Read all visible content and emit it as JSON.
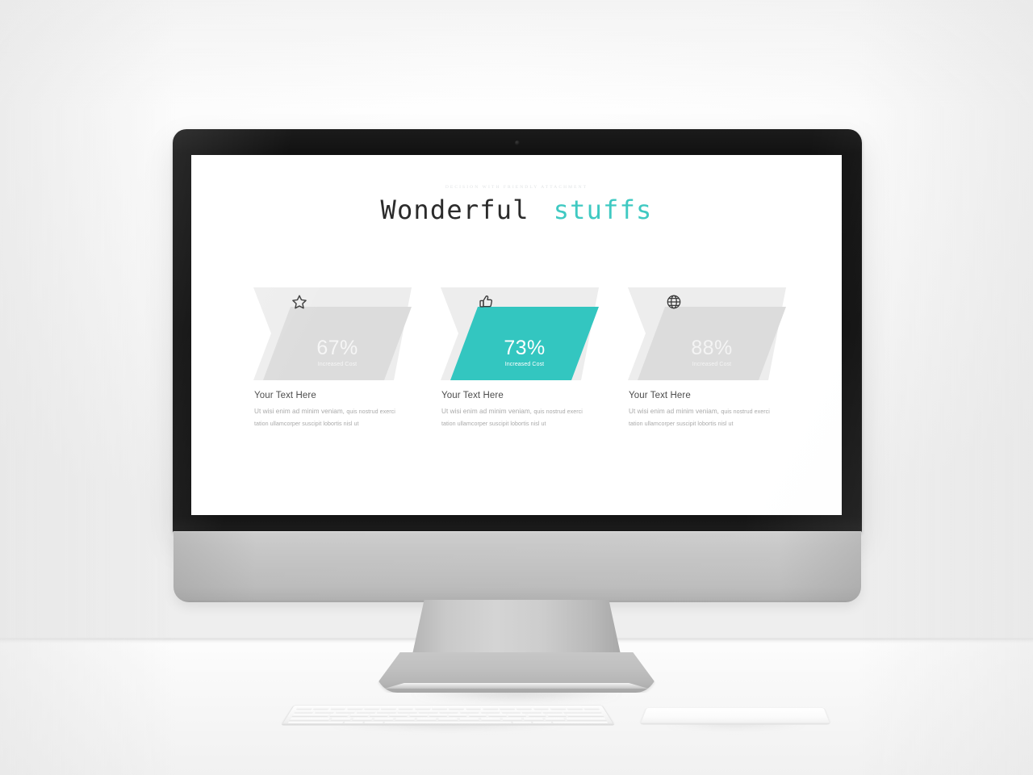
{
  "slide": {
    "eyebrow": "DECISION WITH FRIENDLY ATTACHMENT",
    "headline_primary": "Wonderful",
    "headline_accent": "stuffs",
    "accent_color": "#33c6c0",
    "muted_gray": "#dcdcdc",
    "back_gray": "#ededed",
    "columns": [
      {
        "icon": "star-icon",
        "percent": "67%",
        "metric_label": "Increased Cost",
        "highlighted": false,
        "heading": "Your Text Here",
        "body_lead": "Ut wisi enim ad minim veniam,",
        "body_rest": "quis nostrud exerci tation ullamcorper suscipit lobortis nisl ut"
      },
      {
        "icon": "thumbs-up-icon",
        "percent": "73%",
        "metric_label": "Increased Cost",
        "highlighted": true,
        "heading": "Your Text Here",
        "body_lead": "Ut wisi enim ad minim veniam,",
        "body_rest": "quis nostrud exerci tation ullamcorper suscipit lobortis nisl ut"
      },
      {
        "icon": "globe-icon",
        "percent": "88%",
        "metric_label": "Increased Cost",
        "highlighted": false,
        "heading": "Your Text Here",
        "body_lead": "Ut wisi enim ad minim veniam,",
        "body_rest": "quis nostrud exerci tation ullamcorper suscipit lobortis nisl ut"
      }
    ]
  },
  "device": {
    "type": "desktop-computer-mockup",
    "bezel_color": "#101010",
    "chin_color": "#bcbcbc",
    "peripherals": [
      "keyboard",
      "trackpad"
    ]
  }
}
